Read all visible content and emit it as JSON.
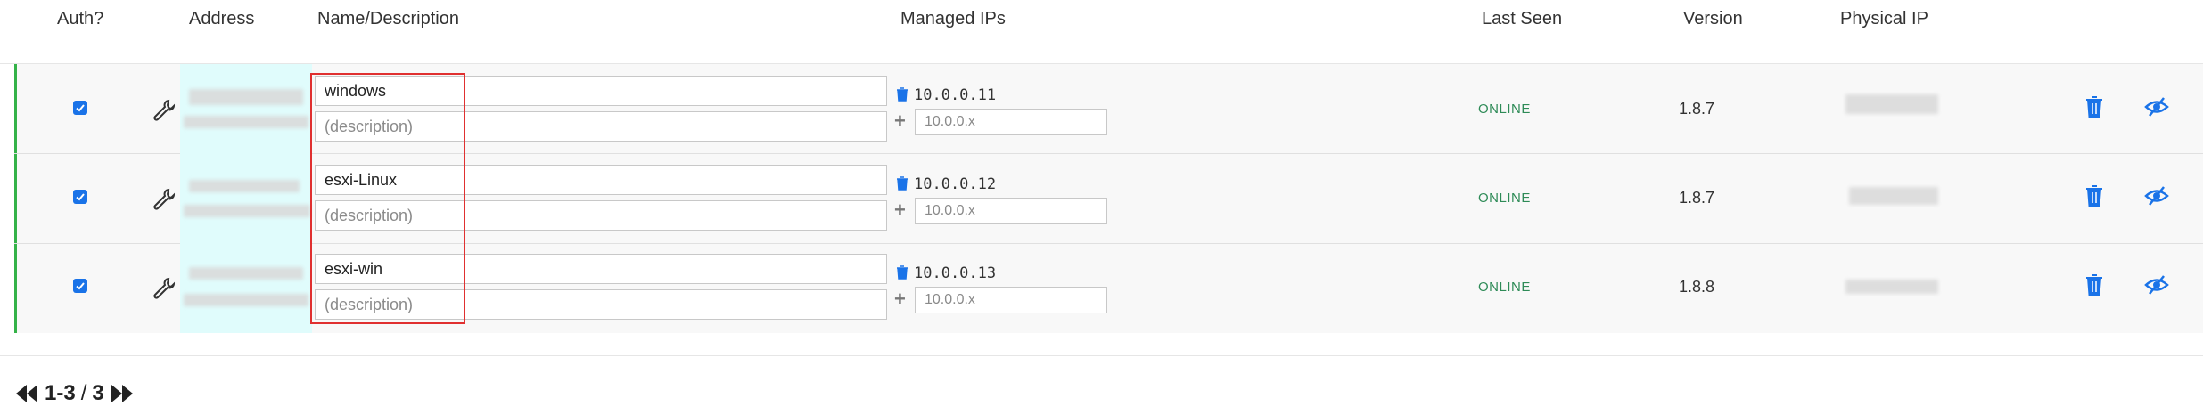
{
  "columns": {
    "auth": "Auth?",
    "address": "Address",
    "name_description": "Name/Description",
    "managed_ips": "Managed IPs",
    "last_seen": "Last Seen",
    "version": "Version",
    "physical_ip": "Physical IP"
  },
  "rows": [
    {
      "authorized": true,
      "name": "windows",
      "description_placeholder": "(description)",
      "managed_ip": "10.0.0.11",
      "ip_placeholder": "10.0.0.x",
      "last_seen": "ONLINE",
      "version": "1.8.7"
    },
    {
      "authorized": true,
      "name": "esxi-Linux",
      "description_placeholder": "(description)",
      "managed_ip": "10.0.0.12",
      "ip_placeholder": "10.0.0.x",
      "last_seen": "ONLINE",
      "version": "1.8.7"
    },
    {
      "authorized": true,
      "name": "esxi-win",
      "description_placeholder": "(description)",
      "managed_ip": "10.0.0.13",
      "ip_placeholder": "10.0.0.x",
      "last_seen": "ONLINE",
      "version": "1.8.8"
    }
  ],
  "pagination": {
    "range": "1-3",
    "separator": "/",
    "total": "3"
  },
  "colors": {
    "accent": "#1a73e8",
    "online": "#2e8b57",
    "row_indicator": "#34b248",
    "highlight_box": "#e03030",
    "address_bg": "#e0fcfc"
  },
  "icons": {
    "edit": "wrench-icon",
    "delete_ip": "trash-icon",
    "add_ip": "plus-icon",
    "delete_member": "trash-icon",
    "hide_member": "eye-slash-icon",
    "first_page": "double-chevron-left-icon",
    "last_page": "double-chevron-right-icon"
  }
}
